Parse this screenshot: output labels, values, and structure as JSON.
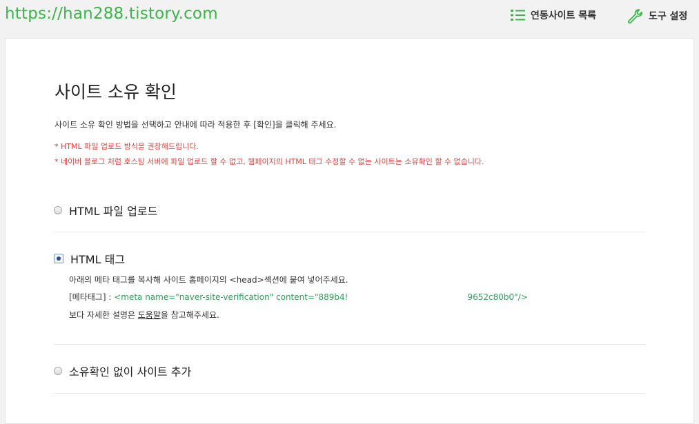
{
  "header": {
    "site_url": "https://han288.tistory.com",
    "linked_sites_label": "연동사이트 목록",
    "tool_settings_label": "도구 설정"
  },
  "main": {
    "title": "사이트 소유 확인",
    "description": "사이트 소유 확인 방법을 선택하고 안내에 따라 적용한 후 [확인]을 클릭해 주세요.",
    "warnings": [
      "* HTML 파일 업로드 방식을 권장해드립니다.",
      "* 네이버 블로그 처럼 호스팅 서버에 파일 업로드 할 수 없고, 웹페이지의 HTML 태그 수정할 수 없는 사이트는 소유확인 할 수 없습니다."
    ],
    "options": {
      "file_upload": {
        "label": "HTML 파일 업로드",
        "selected": false
      },
      "html_tag": {
        "label": "HTML 태그",
        "selected": true,
        "instruction": "아래의 메타 태그를 복사해 사이트 홈페이지의 <head>섹션에 붙여 넣어주세요.",
        "meta_label": "[메타태그] : ",
        "meta_value_start": "<meta name=\"naver-site-verification\" content=\"889b4!",
        "meta_value_end": "9652c80b0\"/>",
        "help_prefix": "보다 자세한 설명은 ",
        "help_link": "도움말",
        "help_suffix": "을 참고해주세요."
      },
      "no_verify": {
        "label": "소유확인 없이 사이트 추가",
        "selected": false
      }
    }
  },
  "colors": {
    "accent_green": "#39b54a",
    "warning_red": "#e0413a",
    "meta_green": "#2e9e5a"
  },
  "icons": {
    "linked_sites": "list-icon",
    "tool_settings": "wrench-icon"
  }
}
